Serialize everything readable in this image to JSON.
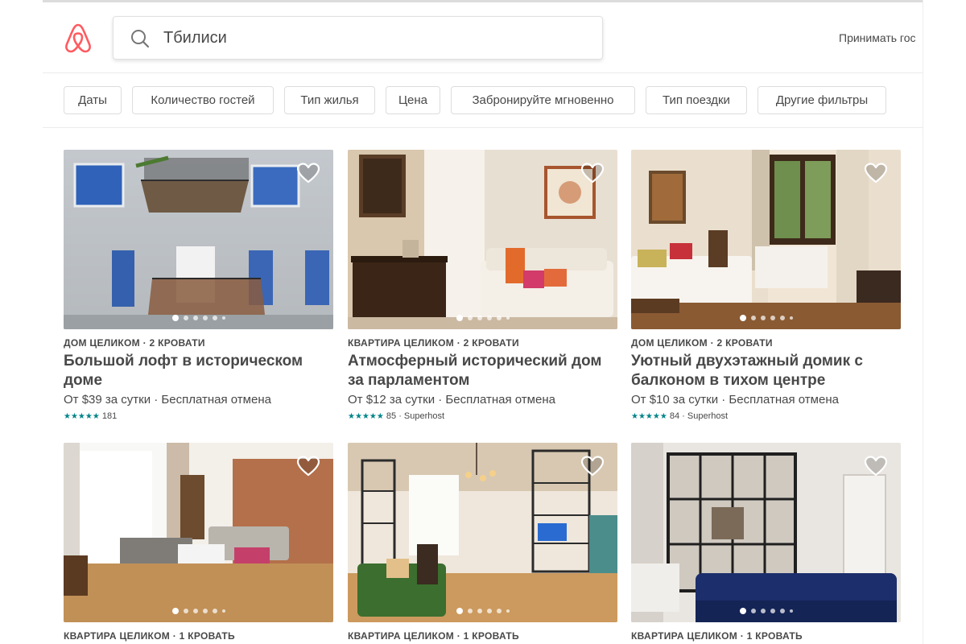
{
  "search": {
    "value": "Тбилиси"
  },
  "header": {
    "host_link": "Принимать гос"
  },
  "filters": [
    "Даты",
    "Количество гостей",
    "Тип жилья",
    "Цена",
    "Забронируйте мгновенно",
    "Тип поездки",
    "Другие фильтры"
  ],
  "accent_color": "#FF5A5F",
  "rating_color": "#008489",
  "icons": {
    "logo": "airbnb-logo",
    "search": "search-icon",
    "favorite": "heart-icon"
  },
  "listings": [
    {
      "kind": "ДОМ ЦЕЛИКОМ · 2 КРОВАТИ",
      "title": "Большой лофт в историческом доме",
      "price": "От $39  за сутки · Бесплатная отмена",
      "stars": "★★★★★",
      "reviews": "181",
      "badge": ""
    },
    {
      "kind": "КВАРТИРА ЦЕЛИКОМ · 2 КРОВАТИ",
      "title": "Атмосферный исторический дом за парламентом",
      "price": "От $12  за сутки · Бесплатная отмена",
      "stars": "★★★★★",
      "reviews": "85",
      "badge": "· Superhost"
    },
    {
      "kind": "ДОМ ЦЕЛИКОМ · 2 КРОВАТИ",
      "title": "Уютный двухэтажный домик с балконом в тихом центре",
      "price": "От $10  за сутки · Бесплатная отмена",
      "stars": "★★★★★",
      "reviews": "84",
      "badge": "· Superhost"
    },
    {
      "kind": "КВАРТИРА ЦЕЛИКОМ · 1 КРОВАТЬ"
    },
    {
      "kind": "КВАРТИРА ЦЕЛИКОМ · 1 КРОВАТЬ"
    },
    {
      "kind": "КВАРТИРА ЦЕЛИКОМ · 1 КРОВАТЬ"
    }
  ]
}
